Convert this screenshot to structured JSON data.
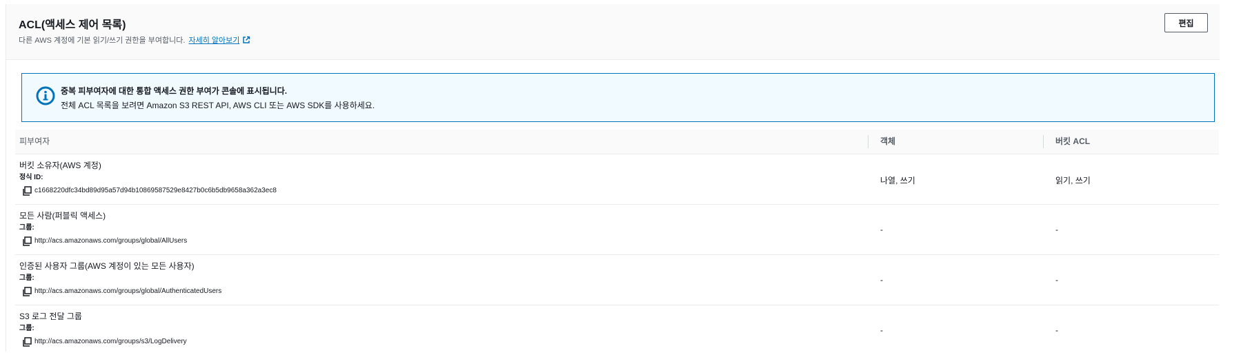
{
  "panel": {
    "title": "ACL(액세스 제어 목록)",
    "description": "다른 AWS 계정에 기본 읽기/쓰기 권한을 부여합니다.",
    "learn_more": "자세히 알아보기",
    "edit_label": "편집"
  },
  "alert": {
    "title": "중복 피부여자에 대한 통합 액세스 권한 부여가 콘솔에 표시됩니다.",
    "body": "전체 ACL 목록을 보려면 Amazon S3 REST API, AWS CLI 또는 AWS SDK를 사용하세요."
  },
  "table": {
    "headers": {
      "grantee": "피부여자",
      "object": "객체",
      "bucket_acl": "버킷 ACL"
    },
    "rows": [
      {
        "name": "버킷 소유자(AWS 계정)",
        "label": "정식 ID:",
        "value": "c1668220dfc34bd89d95a57d94b10869587529e8427b0c6b5db9658a362a3ec8",
        "object": "나열, 쓰기",
        "bucket_acl": "읽기, 쓰기"
      },
      {
        "name": "모든 사람(퍼블릭 액세스)",
        "label": "그룹:",
        "value": "http://acs.amazonaws.com/groups/global/AllUsers",
        "object": "-",
        "bucket_acl": "-"
      },
      {
        "name": "인증된 사용자 그룹(AWS 계정이 있는 모든 사용자)",
        "label": "그룹:",
        "value": "http://acs.amazonaws.com/groups/global/AuthenticatedUsers",
        "object": "-",
        "bucket_acl": "-"
      },
      {
        "name": "S3 로그 전달 그룹",
        "label": "그룹:",
        "value": "http://acs.amazonaws.com/groups/s3/LogDelivery",
        "object": "-",
        "bucket_acl": "-"
      }
    ]
  },
  "colors": {
    "link": "#0073bb",
    "info_bg": "#f1faff",
    "info_border": "#0073bb",
    "text": "#16191f",
    "muted": "#545b64"
  }
}
